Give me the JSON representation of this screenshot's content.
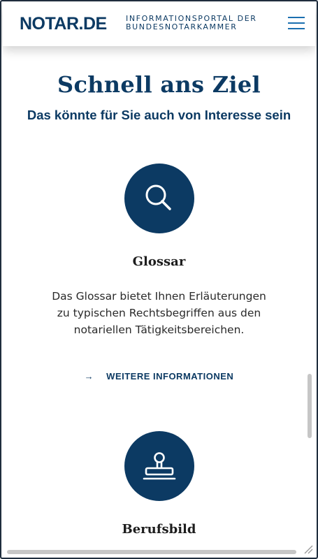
{
  "header": {
    "logo": "NOTAR.DE",
    "tagline_line1": "INFORMATIONSPORTAL DER",
    "tagline_line2": "BUNDESNOTARKAMMER",
    "menu_icon": "hamburger-menu-icon"
  },
  "section": {
    "title": "Schnell ans Ziel",
    "subtitle": "Das könnte für Sie auch von Interesse sein"
  },
  "cards": [
    {
      "icon": "search-icon",
      "title": "Glossar",
      "text": "Das Glossar bietet Ihnen Erläuterungen zu typischen Rechtsbegriffen aus den notariellen Tätigkeitsbereichen.",
      "link_arrow": "→",
      "link_label": "WEITERE INFORMATIONEN"
    },
    {
      "icon": "stamp-icon",
      "title": "Berufsbild"
    }
  ],
  "colors": {
    "brand_navy": "#0c3a63",
    "menu_blue": "#1b6fb0"
  }
}
